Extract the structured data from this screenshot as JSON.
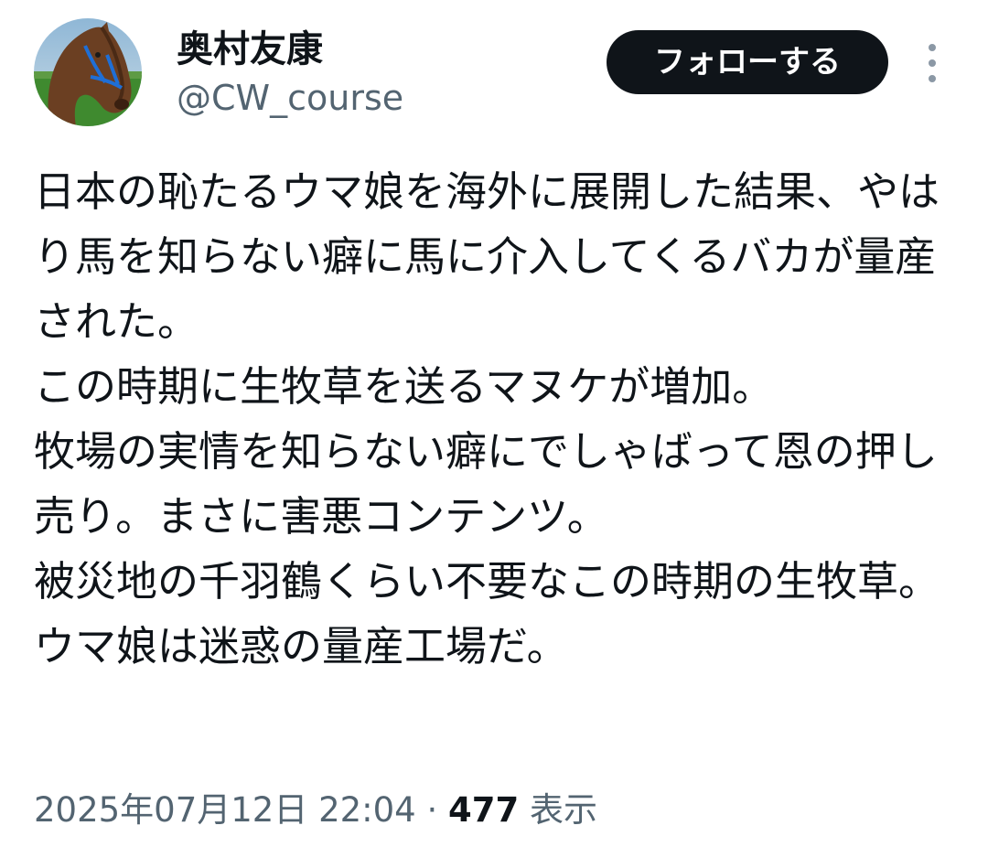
{
  "author": {
    "display_name": "奥村友康",
    "handle": "@CW_course",
    "avatar_icon": "horse-avatar-icon"
  },
  "actions": {
    "follow_label": "フォローする",
    "more_icon": "more-vertical-icon"
  },
  "tweet": {
    "text": "日本の恥たるウマ娘を海外に展開した結果、やはり馬を知らない癖に馬に介入してくるバカが量産された。\nこの時期に生牧草を送るマヌケが増加。\n牧場の実情を知らない癖にでしゃばって恩の押し売り。まさに害悪コンテンツ。\n被災地の千羽鶴くらい不要なこの時期の生牧草。ウマ娘は迷惑の量産工場だ。"
  },
  "meta": {
    "timestamp": "2025年07月12日 22:04",
    "separator": "·",
    "views_count": "477",
    "views_label": "表示"
  },
  "colors": {
    "text_primary": "#0f1419",
    "text_secondary": "#536471",
    "button_bg": "#0f1419",
    "button_text": "#ffffff",
    "icon_gray": "#8b98a5"
  }
}
